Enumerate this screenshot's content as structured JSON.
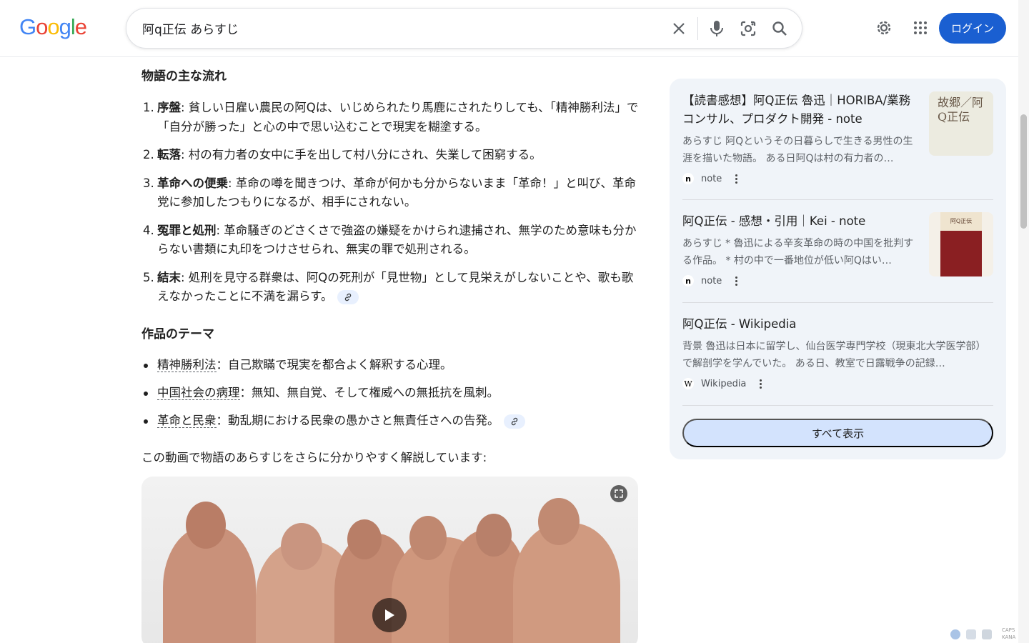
{
  "header": {
    "logo_text": "Google",
    "search_query": "阿q正伝 あらすじ",
    "login_label": "ログイン",
    "icons": [
      "clear-icon",
      "mic-icon",
      "lens-icon",
      "search-icon",
      "settings-gear-icon",
      "apps-grid-icon"
    ]
  },
  "main": {
    "story_heading": "物語の主な流れ",
    "steps": [
      {
        "num": "1.",
        "term": "序盤",
        "text": ": 貧しい日雇い農民の阿Qは、いじめられたり馬鹿にされたりしても、「精神勝利法」で「自分が勝った」と心の中で思い込むことで現実を糊塗する。"
      },
      {
        "num": "2.",
        "term": "転落",
        "text": ": 村の有力者の女中に手を出して村八分にされ、失業して困窮する。"
      },
      {
        "num": "3.",
        "term": "革命への便乗",
        "text": ": 革命の噂を聞きつけ、革命が何かも分からないまま「革命！」と叫び、革命党に参加したつもりになるが、相手にされない。"
      },
      {
        "num": "4.",
        "term": "冤罪と処刑",
        "text": ": 革命騒ぎのどさくさで強盗の嫌疑をかけられ逮捕され、無学のため意味も分からない書類に丸印をつけさせられ、無実の罪で処刑される。"
      },
      {
        "num": "5.",
        "term": "結末",
        "text": ": 処刑を見守る群衆は、阿Qの死刑が「見世物」として見栄えがしないことや、歌も歌えなかったことに不満を漏らす。"
      }
    ],
    "theme_heading": "作品のテーマ",
    "themes": [
      {
        "term": "精神勝利法",
        "text": "：自己欺瞞で現実を都合よく解釈する心理。"
      },
      {
        "term": "中国社会の病理",
        "text": "：無知、無自覚、そして権威への無抵抗を風刺。"
      },
      {
        "term": "革命と民衆",
        "text": "：動乱期における民衆の愚かさと無責任さへの告発。"
      }
    ],
    "video_intro": "この動画で物語のあらすじをさらに分かりやすく解説しています:"
  },
  "sidebar": {
    "cards": [
      {
        "title": "【読書感想】阿Q正伝 魯迅｜HORIBA/業務コンサル、プロダクト開発 - note",
        "desc": "あらすじ 阿Qというその日暮らしで生きる男性の生涯を描いた物語。 ある日阿Qは村の有力者の…",
        "source": "note",
        "source_icon": "n",
        "thumb_text": "故郷／阿Q正伝"
      },
      {
        "title": "阿Q正伝 - 感想・引用｜Kei - note",
        "desc": "あらすじ * 魯迅による辛亥革命の時の中国を批判する作品。 * 村の中で一番地位が低い阿Qはい…",
        "source": "note",
        "source_icon": "n",
        "thumb_text": "阿Q正伝"
      },
      {
        "title": "阿Q正伝 - Wikipedia",
        "desc": "背景 魯迅は日本に留学し、仙台医学専門学校（現東北大学医学部）で解剖学を学んでいた。 ある日、教室で日露戦争の記録…",
        "source": "Wikipedia",
        "source_icon": "W"
      }
    ],
    "show_all_label": "すべて表示"
  },
  "tray": {
    "caps_label": "CAPS",
    "kana_label": "KANA"
  }
}
